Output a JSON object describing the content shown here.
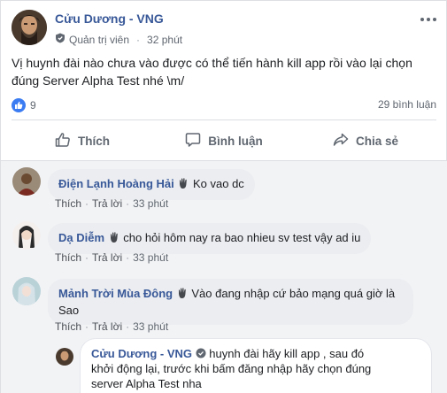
{
  "post": {
    "author": "Cửu Dương - VNG",
    "role": "Quản trị viên",
    "time": "32 phút",
    "text": "Vị huynh đài nào chưa vào được có thể tiến hành kill app rồi vào lại chọn đúng Server Alpha Test nhé \\m/",
    "likes": "9",
    "comment_count": "29 bình luận"
  },
  "actions": {
    "like": "Thích",
    "comment": "Bình luận",
    "share": "Chia sẻ"
  },
  "comments": [
    {
      "name": "Điện Lạnh Hoàng Hải",
      "text": "Ko vao dc",
      "like": "Thích",
      "reply": "Trả lời",
      "time": "33 phút"
    },
    {
      "name": "Dạ Diễm",
      "text": "cho hỏi hôm nay ra bao nhieu sv test vậy ad iu",
      "like": "Thích",
      "reply": "Trả lời",
      "time": "33 phút"
    },
    {
      "name": "Mảnh Trời Mùa Đông",
      "text_line1": "Vào đang nhập cứ bảo mạng quá giờ là",
      "text_line2": "Sao",
      "like": "Thích",
      "reply": "Trả lời",
      "time": "33 phút"
    }
  ],
  "reply": {
    "name": "Cửu Dương - VNG",
    "line1": "huynh đài hãy kill app , sau đó",
    "line2": "khởi động lại, trước khi bấm đăng nhập hãy chọn đúng",
    "line3": "server Alpha Test nha"
  },
  "colors": {
    "link_blue": "#385898",
    "like_blue": "#3b7cf2",
    "muted": "#606770"
  }
}
